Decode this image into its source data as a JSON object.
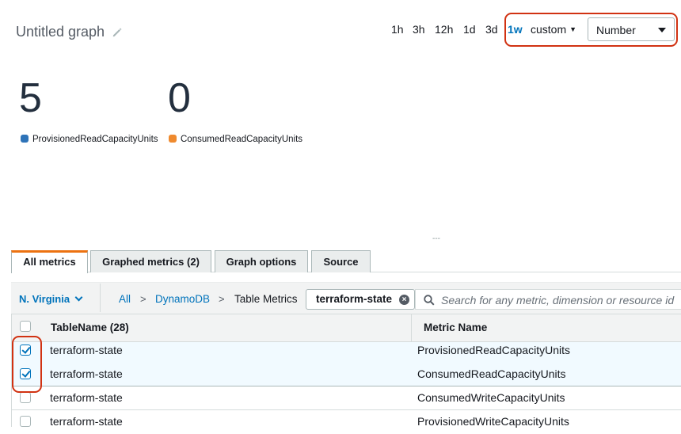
{
  "graph": {
    "title": "Untitled graph",
    "time_ranges": [
      "1h",
      "3h",
      "12h",
      "1d",
      "3d",
      "1w"
    ],
    "active_time_range": "1w",
    "custom_label": "custom",
    "view_select": "Number"
  },
  "metrics": [
    {
      "value": "5",
      "label": "ProvisionedReadCapacityUnits",
      "color": "#1f77b4"
    },
    {
      "value": "0",
      "label": "ConsumedReadCapacityUnits",
      "color": "#ff7f0e"
    }
  ],
  "divider": "---",
  "tabs": [
    "All metrics",
    "Graphed metrics (2)",
    "Graph options",
    "Source"
  ],
  "active_tab": "All metrics",
  "browse": {
    "region": "N. Virginia",
    "breadcrumb": [
      "All",
      "DynamoDB",
      "Table Metrics"
    ],
    "breadcrumb_sep": ">",
    "filter_token": "terraform-state",
    "search_placeholder": "Search for any metric, dimension or resource id"
  },
  "table": {
    "headers": {
      "table_name": "TableName",
      "count": "(28)",
      "metric_name": "Metric Name"
    },
    "rows": [
      {
        "table": "terraform-state",
        "metric": "ProvisionedReadCapacityUnits",
        "checked": true
      },
      {
        "table": "terraform-state",
        "metric": "ConsumedReadCapacityUnits",
        "checked": true
      },
      {
        "table": "terraform-state",
        "metric": "ConsumedWriteCapacityUnits",
        "checked": false
      },
      {
        "table": "terraform-state",
        "metric": "ProvisionedWriteCapacityUnits",
        "checked": false
      }
    ]
  },
  "colors": {
    "accent": "#0073bb",
    "highlight": "#d13212",
    "tab_accent": "#ec7211"
  }
}
